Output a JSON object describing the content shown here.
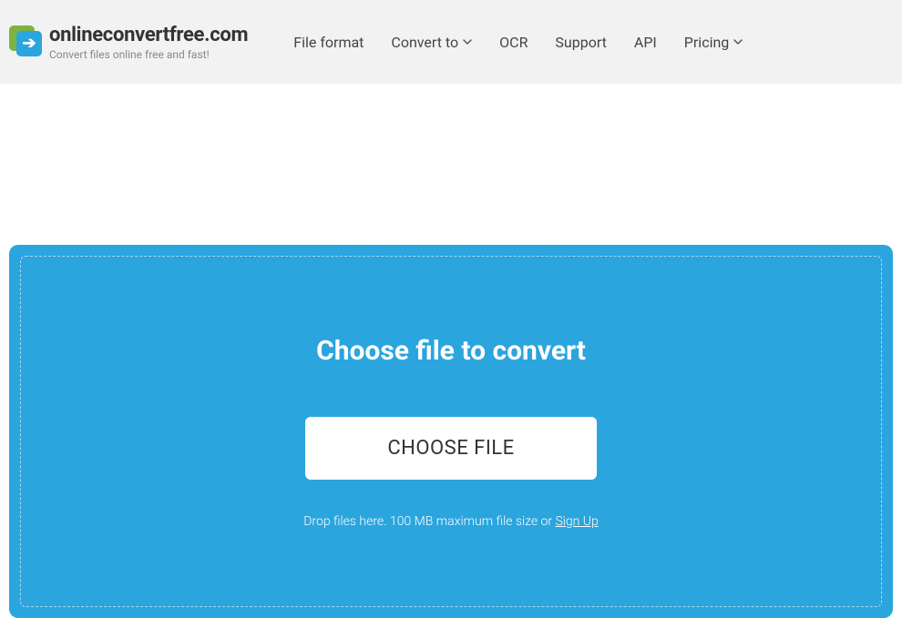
{
  "header": {
    "site_name": "onlineconvertfree.com",
    "tagline": "Convert files online free and fast!",
    "nav": {
      "file_format": "File format",
      "convert_to": "Convert to",
      "ocr": "OCR",
      "support": "Support",
      "api": "API",
      "pricing": "Pricing"
    }
  },
  "dropzone": {
    "title": "Choose file to convert",
    "button_label": "CHOOSE FILE",
    "drop_text": "Drop files here. 100 MB maximum file size or ",
    "signup_label": "Sign Up"
  }
}
